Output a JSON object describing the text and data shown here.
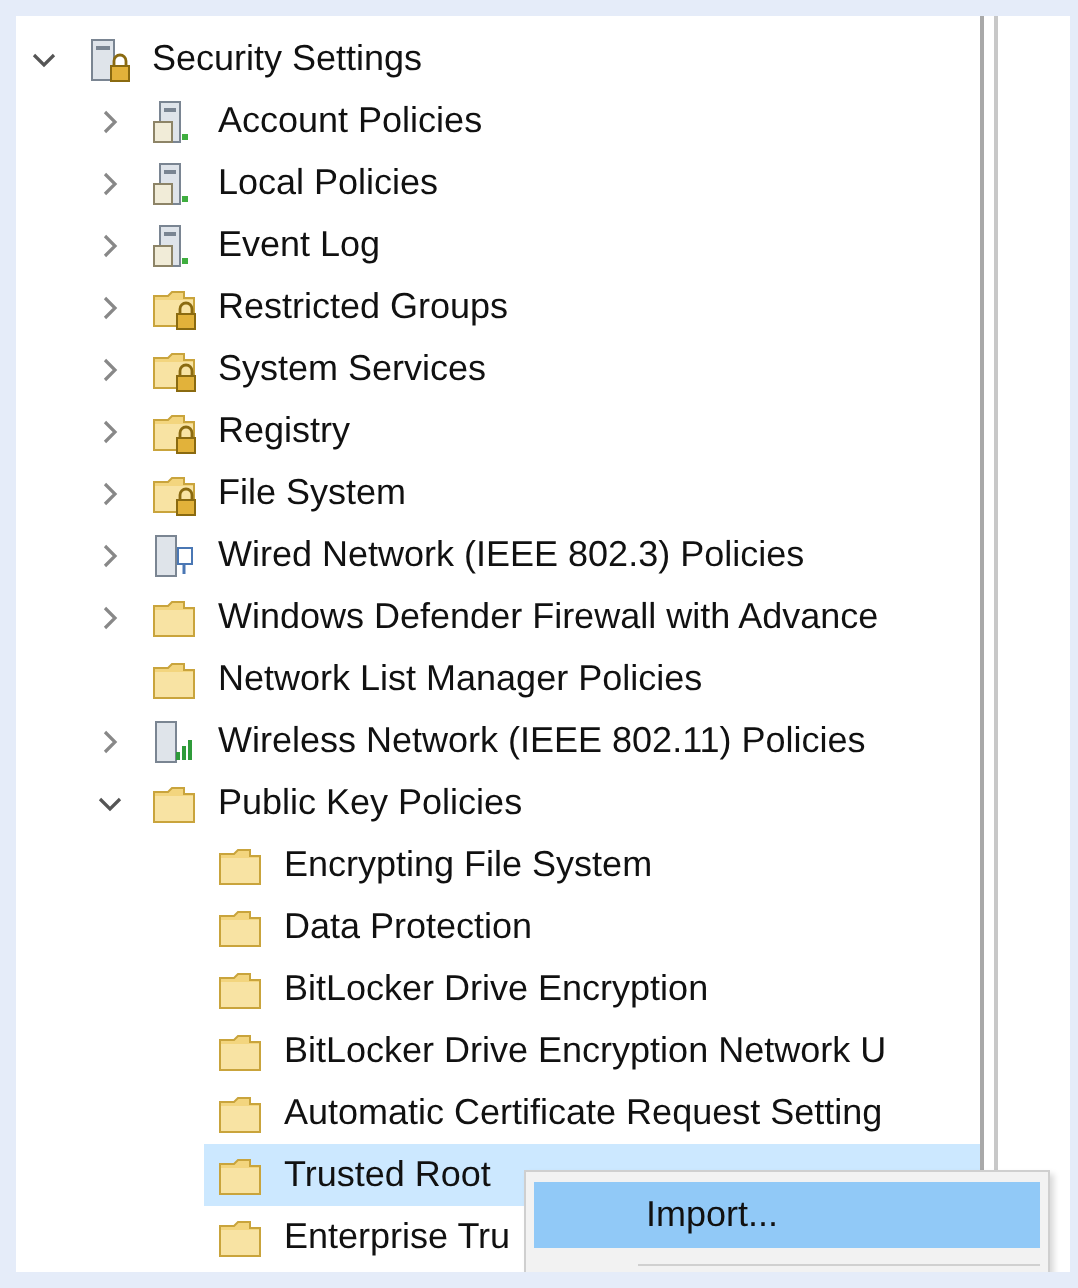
{
  "tree": [
    {
      "label": "Security Settings",
      "kind": "security",
      "expanded": true,
      "selected": false,
      "children": [
        {
          "label": "Account Policies",
          "kind": "policy",
          "expanded": false,
          "selected": false
        },
        {
          "label": "Local Policies",
          "kind": "policy",
          "expanded": false,
          "selected": false
        },
        {
          "label": "Event Log",
          "kind": "policy",
          "expanded": false,
          "selected": false
        },
        {
          "label": "Restricted Groups",
          "kind": "lockfolder",
          "expanded": false,
          "selected": false
        },
        {
          "label": "System Services",
          "kind": "lockfolder",
          "expanded": false,
          "selected": false
        },
        {
          "label": "Registry",
          "kind": "lockfolder",
          "expanded": false,
          "selected": false
        },
        {
          "label": "File System",
          "kind": "lockfolder",
          "expanded": false,
          "selected": false
        },
        {
          "label": "Wired Network (IEEE 802.3) Policies",
          "kind": "wired",
          "expanded": false,
          "selected": false
        },
        {
          "label": "Windows Defender Firewall with Advance",
          "kind": "folder",
          "expanded": false,
          "selected": false
        },
        {
          "label": "Network List Manager Policies",
          "kind": "folder",
          "selected": false
        },
        {
          "label": "Wireless Network (IEEE 802.11) Policies",
          "kind": "wireless",
          "expanded": false,
          "selected": false
        },
        {
          "label": "Public Key Policies",
          "kind": "folder",
          "expanded": true,
          "selected": false,
          "children": [
            {
              "label": "Encrypting File System",
              "kind": "folder",
              "selected": false
            },
            {
              "label": "Data Protection",
              "kind": "folder",
              "selected": false
            },
            {
              "label": "BitLocker Drive Encryption",
              "kind": "folder",
              "selected": false
            },
            {
              "label": "BitLocker Drive Encryption Network U",
              "kind": "folder",
              "selected": false
            },
            {
              "label": "Automatic Certificate Request Setting",
              "kind": "folder",
              "selected": false
            },
            {
              "label": "Trusted Root",
              "kind": "folder",
              "selected": true
            },
            {
              "label": "Enterprise Tru",
              "kind": "folder",
              "selected": false
            }
          ]
        }
      ]
    }
  ],
  "context_menu": {
    "items": [
      {
        "label": "Import...",
        "selected": true
      }
    ]
  }
}
